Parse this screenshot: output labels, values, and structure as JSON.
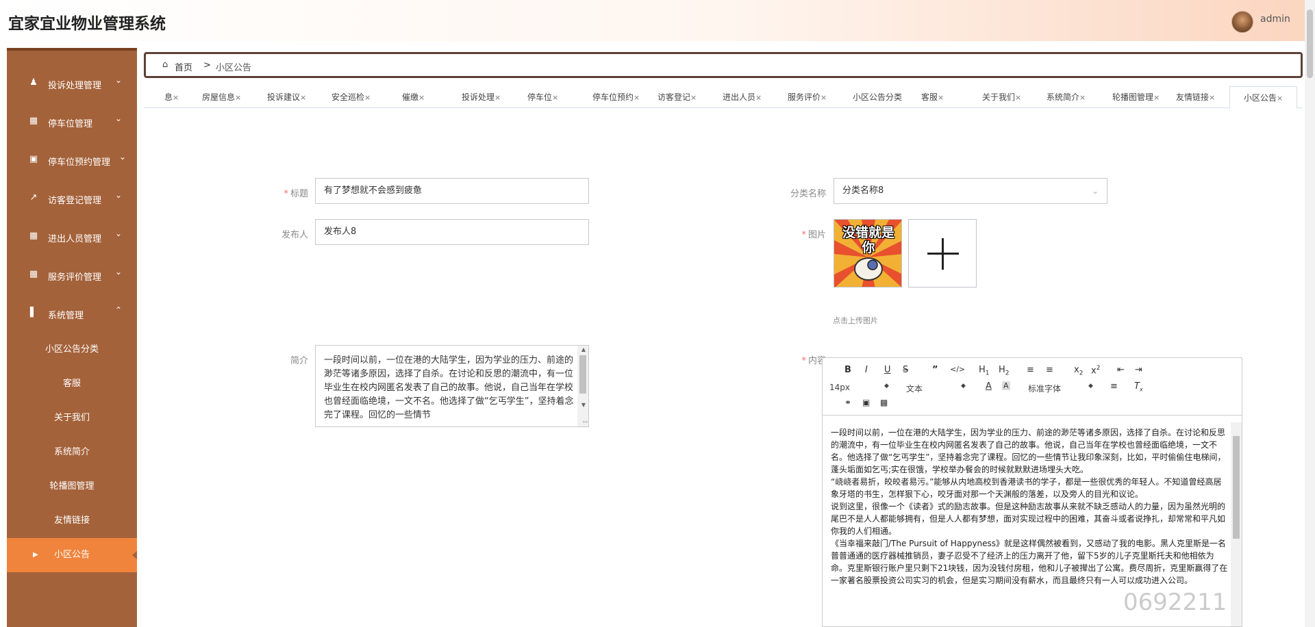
{
  "header": {
    "app_title": "宜家宜业物业管理系统",
    "username": "admin"
  },
  "sidebar": {
    "items": [
      {
        "label": "投诉处理管理",
        "icon": "person-icon"
      },
      {
        "label": "停车位管理",
        "icon": "grid-icon"
      },
      {
        "label": "停车位预约管理",
        "icon": "monitor-icon"
      },
      {
        "label": "访客登记管理",
        "icon": "chart-icon"
      },
      {
        "label": "进出人员管理",
        "icon": "grid-icon"
      },
      {
        "label": "服务评价管理",
        "icon": "grid-icon"
      },
      {
        "label": "系统管理",
        "icon": "bar-chart-icon"
      }
    ],
    "sub_items": [
      "小区公告分类",
      "客服",
      "关于我们",
      "系统简介",
      "轮播图管理",
      "友情链接",
      "小区公告"
    ]
  },
  "breadcrumb": {
    "home": "首页",
    "separator": ">",
    "current": "小区公告"
  },
  "tabs": [
    {
      "label": "息",
      "close": "×"
    },
    {
      "label": "房屋信息",
      "close": "×"
    },
    {
      "label": "投诉建议",
      "close": "×"
    },
    {
      "label": "安全巡检",
      "close": "×"
    },
    {
      "label": "催缴",
      "close": "×"
    },
    {
      "label": "投诉处理",
      "close": "×"
    },
    {
      "label": "停车位",
      "close": "×"
    },
    {
      "label": "停车位预约",
      "close": "×"
    },
    {
      "label": "访客登记",
      "close": "×"
    },
    {
      "label": "进出人员",
      "close": "×"
    },
    {
      "label": "服务评价",
      "close": "×"
    },
    {
      "label": "小区公告分类",
      "close": ""
    },
    {
      "label": "客服",
      "close": "×"
    },
    {
      "label": "关于我们",
      "close": "×"
    },
    {
      "label": "系统简介",
      "close": "×"
    },
    {
      "label": "轮播图管理",
      "close": "×"
    },
    {
      "label": "友情链接",
      "close": "×"
    },
    {
      "label": "小区公告",
      "close": "×"
    }
  ],
  "form": {
    "title_label": "标题",
    "title_value": "有了梦想就不会感到疲惫",
    "category_label": "分类名称",
    "category_value": "分类名称8",
    "publisher_label": "发布人",
    "publisher_value": "发布人8",
    "image_label": "图片",
    "image_text": "没错就是你",
    "upload_hint": "点击上传图片",
    "intro_label": "简介",
    "intro_text": "一段时间以前，一位在港的大陆学生，因为学业的压力、前途的渺茫等诸多原因，选择了自杀。在讨论和反思的潮流中，有一位毕业生在校内网匿名发表了自己的故事。他说，自己当年在学校也曾经面临绝境，一文不名。他选择了做“乞丐学生”，坚持着念完了课程。回忆的一些情节",
    "content_label": "内容"
  },
  "editor": {
    "font_size": "14px",
    "block_type": "文本",
    "font_family": "标准字体",
    "paragraphs": [
      "一段时间以前，一位在港的大陆学生，因为学业的压力、前途的渺茫等诸多原因，选择了自杀。在讨论和反思的潮流中，有一位毕业生在校内网匿名发表了自己的故事。他说，自己当年在学校也曾经面临绝境，一文不名。他选择了做“乞丐学生”，坚持着念完了课程。回忆的一些情节让我印象深刻，比如，平时偷偷住电梯间，蓬头垢面如乞丐;实在很饿，学校举办餐会的时候就默默进场埋头大吃。",
      "“峣峣者易折，皎皎者易污。”能够从内地高校到香港读书的学子，都是一些很优秀的年轻人。不知道曾经高居象牙塔的书生，怎样狠下心，咬牙面对那一个天渊般的落差，以及旁人的目光和议论。",
      "说到这里，很像一个《读者》式的励志故事。但是这种励志故事从来就不缺乏感动人的力量，因为虽然光明的尾巴不是人人都能够拥有，但是人人都有梦想，面对实现过程中的困难，其奋斗或者说挣扎，却常常和平凡如你我的人们相通。",
      "《当幸福来敲门/The Pursuit of Happyness》就是这样偶然被看到，又感动了我的电影。黑人克里斯是一名普普通通的医疗器械推销员，妻子忍受不了经济上的压力离开了他，留下5岁的儿子克里斯托夫和他相依为命。克里斯银行账户里只剩下21块钱，因为没钱付房租，他和儿子被撵出了公寓。费尽周折，克里斯赢得了在一家著名股票投资公司实习的机会，但是实习期间没有薪水，而且最终只有一人可以成功进入公司。"
    ]
  },
  "watermark": "0692211"
}
